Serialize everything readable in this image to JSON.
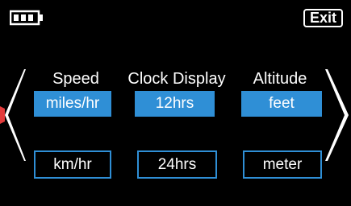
{
  "status": {
    "battery_icon": "battery-icon"
  },
  "header": {
    "exit_label": "Exit"
  },
  "nav": {
    "prev_icon": "chevron-left-icon",
    "next_icon": "chevron-right-icon"
  },
  "columns": [
    {
      "label": "Speed",
      "options": [
        "miles/hr",
        "km/hr"
      ],
      "selected": "miles/hr"
    },
    {
      "label": "Clock Display",
      "options": [
        "12hrs",
        "24hrs"
      ],
      "selected": "12hrs"
    },
    {
      "label": "Altitude",
      "options": [
        "feet",
        "meter"
      ],
      "selected": "feet"
    }
  ],
  "colors": {
    "accent": "#2f8fd6",
    "background": "#000000",
    "text": "#ffffff",
    "pointer": "#e23b3b"
  }
}
